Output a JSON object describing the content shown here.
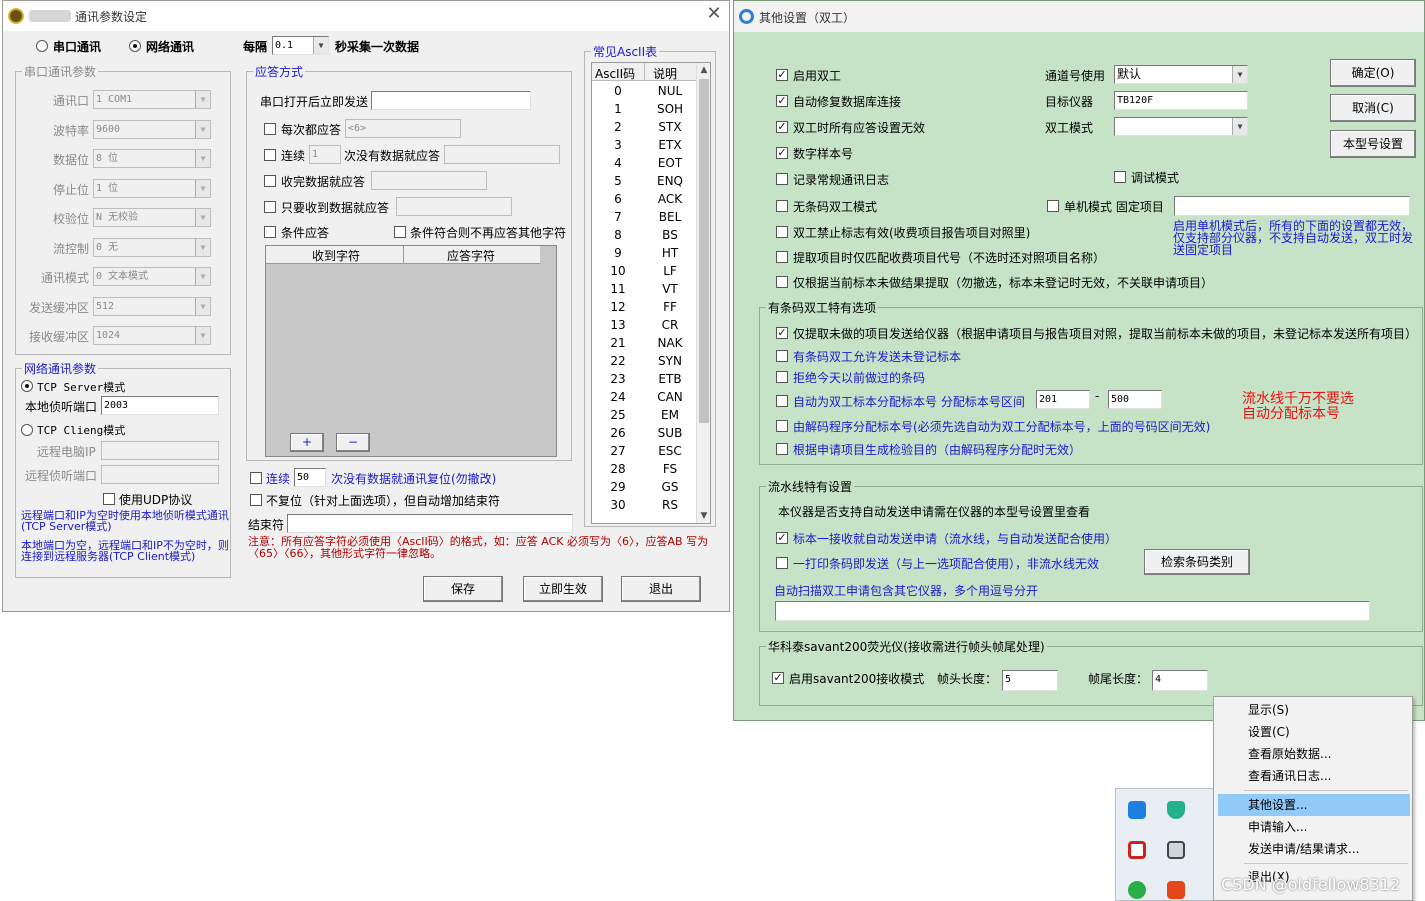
{
  "left_window": {
    "title": "通讯参数设定",
    "radio_serial": "串口通讯",
    "radio_network": "网络通讯",
    "every_label": "每隔",
    "interval_value": "0.1",
    "interval_suffix": "秒采集一次数据",
    "serial_group": {
      "title": "串口通讯参数",
      "rows": [
        {
          "label": "通讯口",
          "value": "1 COM1"
        },
        {
          "label": "波特率",
          "value": "9600"
        },
        {
          "label": "数据位",
          "value": "8 位"
        },
        {
          "label": "停止位",
          "value": "1 位"
        },
        {
          "label": "校验位",
          "value": "N 无校验"
        },
        {
          "label": "流控制",
          "value": "0 无"
        },
        {
          "label": "通讯模式",
          "value": "0 文本模式"
        },
        {
          "label": "发送缓冲区",
          "value": "512"
        },
        {
          "label": "接收缓冲区",
          "value": "1024"
        }
      ]
    },
    "network_group": {
      "title": "网络通讯参数",
      "tcp_server": "TCP Server模式",
      "local_port_label": "本地侦听端口",
      "local_port_value": "2003",
      "tcp_client": "TCP Clieng模式",
      "remote_ip_label": "远程电脑IP",
      "remote_port_label": "远程侦听端口",
      "use_udp": "使用UDP协议",
      "note1": "远程端口和IP为空时使用本地侦听模式通讯(TCP Server模式)",
      "note2": "本地端口为空，远程端口和IP不为空时，则连接到远程服务器(TCP Client模式)"
    },
    "response_group": {
      "title": "应答方式",
      "send_on_open": "串口打开后立即发送",
      "every_response": "每次都应答",
      "every_response_value": "<6>",
      "consecutive": "连续",
      "consecutive_value": "1",
      "consecutive_suffix": "次没有数据就应答",
      "recv_done": "收完数据就应答",
      "only_recv": "只要收到数据就应答",
      "conditional": "条件应答",
      "cond_stop": "条件符合则不再应答其他字符",
      "col_recv": "收到字符",
      "col_resp": "应答字符",
      "add_btn": "+",
      "del_btn": "−"
    },
    "reset_consecutive": "连续",
    "reset_value": "50",
    "reset_suffix": "次没有数据就通讯复位(勿撤改)",
    "no_reset": "不复位（针对上面选项），但自动增加结束符",
    "end_char_label": "结束符",
    "warning": "注意：所有应答字符必须使用〈AscII码〉的格式，如：应答 ACK 必须写为〈6〉，应答AB 写为〈65〉〈66〉，其他形式字符一律忽略。",
    "ascii_group_title": "常见AscII表",
    "ascii_header": [
      "AscII码",
      "说明"
    ],
    "ascii_rows": [
      [
        "0",
        "NUL"
      ],
      [
        "1",
        "SOH"
      ],
      [
        "2",
        "STX"
      ],
      [
        "3",
        "ETX"
      ],
      [
        "4",
        "EOT"
      ],
      [
        "5",
        "ENQ"
      ],
      [
        "6",
        "ACK"
      ],
      [
        "7",
        "BEL"
      ],
      [
        "8",
        "BS"
      ],
      [
        "9",
        "HT"
      ],
      [
        "10",
        "LF"
      ],
      [
        "11",
        "VT"
      ],
      [
        "12",
        "FF"
      ],
      [
        "13",
        "CR"
      ],
      [
        "21",
        "NAK"
      ],
      [
        "22",
        "SYN"
      ],
      [
        "23",
        "ETB"
      ],
      [
        "24",
        "CAN"
      ],
      [
        "25",
        "EM"
      ],
      [
        "26",
        "SUB"
      ],
      [
        "27",
        "ESC"
      ],
      [
        "28",
        "FS"
      ],
      [
        "29",
        "GS"
      ],
      [
        "30",
        "RS"
      ]
    ],
    "btn_save": "保存",
    "btn_apply": "立即生效",
    "btn_exit": "退出"
  },
  "right_window": {
    "title": "其他设置（双工）",
    "btn_ok": "确定(O)",
    "btn_cancel": "取消(C)",
    "btn_model": "本型号设置",
    "enable_duplex": "启用双工",
    "auto_repair": "自动修复数据库连接",
    "all_resp_invalid": "双工时所有应答设置无效",
    "numeric_sample": "数字样本号",
    "log_normal": "记录常规通讯日志",
    "debug_mode": "调试模式",
    "no_barcode": "无条码双工模式",
    "single_mode": "单机模式 固定项目",
    "forbid_flag": "双工禁止标志有效(收费项目报告项目对照里)",
    "extract_code": "提取项目时仅匹配收费项目代号（不选时还对照项目名称）",
    "extract_unmarked": "仅根据当前标本未做结果提取（勿撤选，标本未登记时无效，不关联申请项目）",
    "channel_label": "通道号使用",
    "channel_value": "默认",
    "target_label": "目标仪器",
    "target_value": "TB120F",
    "duplex_mode_label": "双工模式",
    "duplex_mode_value": "",
    "single_note": "启用单机模式后，所有的下面的设置都无效，仅支持部分仪器，不支持自动发送，双工时发送固定项目",
    "barcode_group": {
      "title": "有条码双工特有选项",
      "opt1": "仅提取未做的项目发送给仪器（根据申请项目与报告项目对照，提取当前标本未做的项目，未登记标本发送所有项目）",
      "opt2": "有条码双工允许发送未登记标本",
      "opt3": "拒绝今天以前做过的条码",
      "opt4": "自动为双工标本分配标本号  分配标本号区间",
      "range_from": "201",
      "range_sep": "-",
      "range_to": "500",
      "opt5": "由解码程序分配标本号(必须先选自动为双工分配标本号，上面的号码区间无效)",
      "opt6": "根据申请项目生成检验目的（由解码程序分配时无效）",
      "red_note": "流水线千万不要选自动分配标本号"
    },
    "pipeline_group": {
      "title": "流水线特有设置",
      "desc": "本仪器是否支持自动发送申请需在仪器的本型号设置里查看",
      "opt1": "标本一接收就自动发送申请（流水线，与自动发送配合使用）",
      "opt2": "一打印条码即发送（与上一选项配合使用），非流水线无效",
      "btn_search": "检索条码类别",
      "scan_label": "自动扫描双工申请包含其它仪器，多个用逗号分开",
      "scan_value": ""
    },
    "savant_group": {
      "title": "华科泰savant200荧光仪(接收需进行帧头帧尾处理)",
      "enable": "启用savant200接收模式",
      "head_label": "帧头长度：",
      "head_value": "5",
      "tail_label": "帧尾长度：",
      "tail_value": "4"
    },
    "checked": {
      "enable_duplex": true,
      "auto_repair": true,
      "all_resp_invalid": true,
      "numeric_sample": true,
      "log_normal": false,
      "debug_mode": false,
      "no_barcode": false,
      "single_mode": false,
      "forbid_flag": false,
      "extract_code": false,
      "extract_unmarked": false,
      "bc1": true,
      "bc2": false,
      "bc3": false,
      "bc4": false,
      "bc5": false,
      "bc6": false,
      "pl1": true,
      "pl2": false,
      "sv": true
    }
  },
  "context_menu": {
    "items": [
      "显示(S)",
      "设置(C)",
      "查看原始数据...",
      "查看通讯日志...",
      "其他设置...",
      "申请输入...",
      "发送申请/结果请求...",
      "退出(X)"
    ],
    "highlighted": "其他设置..."
  },
  "watermark": "CSDN @oldfellow8312",
  "colors": {
    "right_bg": "#c7e3c7",
    "menu_highlight": "#91c9f7",
    "note_blue": "#1a1acb",
    "warning_red": "#b00000",
    "pipeline_red": "#ee1111"
  }
}
